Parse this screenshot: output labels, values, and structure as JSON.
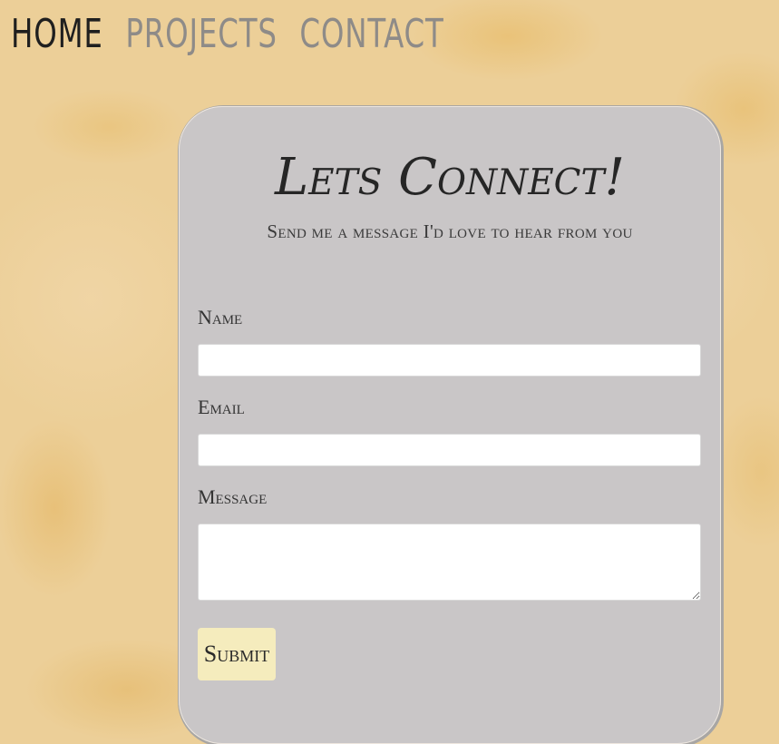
{
  "nav": {
    "items": [
      {
        "label": "HOME",
        "active": true
      },
      {
        "label": "PROJECTS",
        "active": false
      },
      {
        "label": "CONTACT",
        "active": false
      }
    ]
  },
  "contact_form": {
    "title": "Lets Connect!",
    "subtitle": "Send me a message I'd love to hear from you",
    "name_label": "Name",
    "name_value": "",
    "email_label": "Email",
    "email_value": "",
    "message_label": "Message",
    "message_value": "",
    "submit_label": "Submit"
  },
  "colors": {
    "background": "#eccf98",
    "card": "#c9c6c7",
    "nav_active": "#1f1f1f",
    "nav_inactive": "#8e8b88",
    "submit_button": "#f5ecbd"
  }
}
